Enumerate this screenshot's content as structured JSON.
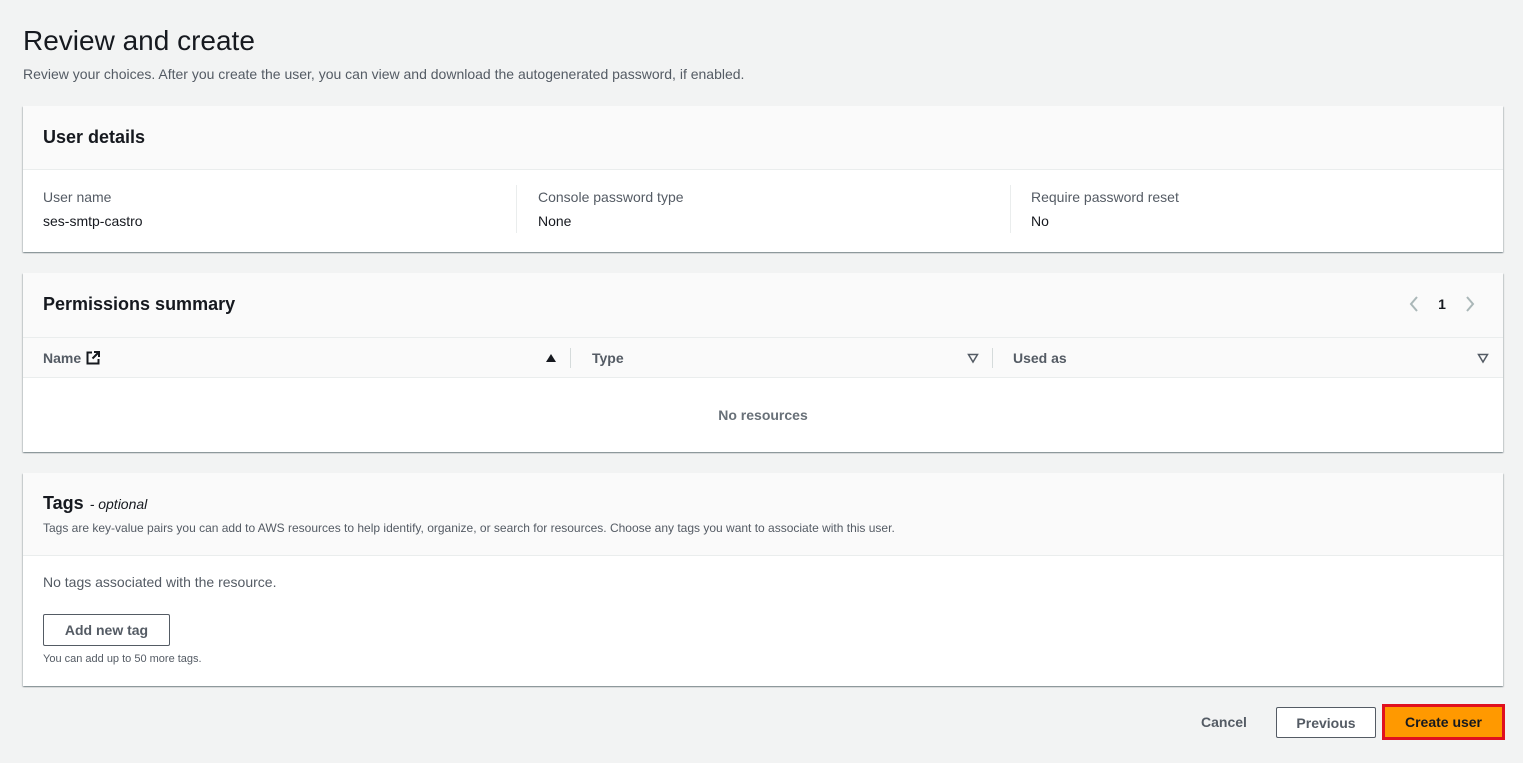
{
  "page": {
    "title": "Review and create",
    "description": "Review your choices. After you create the user, you can view and download the autogenerated password, if enabled."
  },
  "user_details": {
    "title": "User details",
    "fields": [
      {
        "label": "User name",
        "value": "ses-smtp-castro"
      },
      {
        "label": "Console password type",
        "value": "None"
      },
      {
        "label": "Require password reset",
        "value": "No"
      }
    ]
  },
  "permissions": {
    "title": "Permissions summary",
    "page_number": "1",
    "columns": [
      {
        "label": "Name",
        "icon": "external-link-icon",
        "sort": "ascending"
      },
      {
        "label": "Type",
        "sort": "none"
      },
      {
        "label": "Used as",
        "sort": "none"
      }
    ],
    "empty_text": "No resources"
  },
  "tags": {
    "title": "Tags",
    "optional_label": "- optional",
    "description": "Tags are key-value pairs you can add to AWS resources to help identify, organize, or search for resources. Choose any tags you want to associate with this user.",
    "empty_text": "No tags associated with the resource.",
    "add_button": "Add new tag",
    "limit_text": "You can add up to 50 more tags."
  },
  "actions": {
    "cancel": "Cancel",
    "previous": "Previous",
    "create": "Create user"
  },
  "colors": {
    "background": "#f2f3f3",
    "primary_button": "#ff9900",
    "highlight_border": "#e0101f",
    "text_secondary": "#545b64"
  }
}
